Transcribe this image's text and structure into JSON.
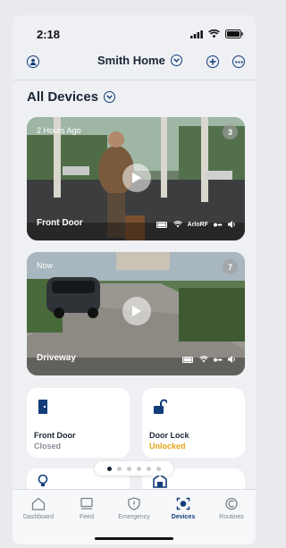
{
  "status_bar": {
    "time": "2:18"
  },
  "header": {
    "title": "Smith Home"
  },
  "section": {
    "title": "All Devices"
  },
  "cameras": [
    {
      "time_label": "2 Hours Ago",
      "count": "3",
      "name": "Front Door",
      "network": "ArloRF"
    },
    {
      "time_label": "Now",
      "count": "7",
      "name": "Driveway"
    }
  ],
  "tiles": [
    {
      "label": "Front Door",
      "status": "Closed",
      "status_color": "#8a8f98"
    },
    {
      "label": "Door Lock",
      "status": "Unlocked",
      "status_color": "#e8a317"
    }
  ],
  "pager": {
    "count": 6,
    "active": 0
  },
  "tabs": [
    {
      "label": "Dashboard",
      "icon": "home-icon"
    },
    {
      "label": "Feed",
      "icon": "feed-icon"
    },
    {
      "label": "Emergency",
      "icon": "shield-icon"
    },
    {
      "label": "Devices",
      "icon": "devices-icon",
      "active": true
    },
    {
      "label": "Routines",
      "icon": "routines-icon"
    }
  ],
  "colors": {
    "accent": "#123d79",
    "warning": "#e8a317",
    "background": "#eef0f4"
  }
}
